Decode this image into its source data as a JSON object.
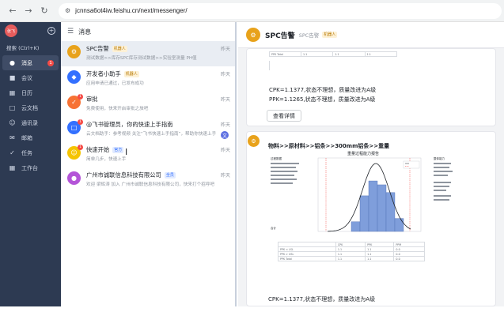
{
  "browser": {
    "url": "jcnnsa6ot4iw.feishu.cn/next/messenger/",
    "back_icon": "arrow-left-icon",
    "forward_icon": "arrow-right-icon",
    "reload_icon": "reload-icon"
  },
  "sidebar": {
    "avatar_text": "张飞",
    "search_label": "搜索 (Ctrl+K)",
    "items": [
      {
        "label": "消息",
        "icon": "chat-icon",
        "badge": "1",
        "active": true
      },
      {
        "label": "会议",
        "icon": "video-icon"
      },
      {
        "label": "日历",
        "icon": "calendar-icon"
      },
      {
        "label": "云文档",
        "icon": "doc-icon"
      },
      {
        "label": "通讯录",
        "icon": "contacts-icon"
      },
      {
        "label": "邮箱",
        "icon": "mail-icon"
      },
      {
        "label": "任务",
        "icon": "task-icon"
      },
      {
        "label": "工作台",
        "icon": "apps-icon"
      }
    ]
  },
  "chat_list": {
    "header": "消息",
    "items": [
      {
        "title": "SPC告警",
        "tag": "机器人",
        "time": "昨天",
        "preview": "测试数据>>库存SPC库存测试数据>>实验室测量 PH值",
        "color": "#e8a21b"
      },
      {
        "title": "开发者小助手",
        "tag": "机器人",
        "time": "昨天",
        "preview": "应用申请已通过，已发布成功",
        "color": "#3370ff"
      },
      {
        "title": "审批",
        "tag": "",
        "time": "昨天",
        "preview": "免费使用，快来开启审批之旅吧",
        "color": "#f77234",
        "badge": "1"
      },
      {
        "title": "@飞书管理员，你的快速上手指南",
        "tag": "",
        "time": "昨天",
        "preview": "云文档助手：参考视频 关注“飞书快速上手指南”，帮助你快速上手",
        "color": "#3370ff",
        "badge": "1",
        "chip": "文"
      },
      {
        "title": "快速开始",
        "tag": "官方",
        "tag_style": "blue",
        "time": "昨天",
        "preview": "简单几步，快速上手",
        "color": "#f5c400",
        "badge": "1"
      },
      {
        "title": "广州市诚联信息科技有限公司",
        "tag": "全员",
        "tag_style": "blue",
        "time": "昨天",
        "preview": "欢迎 梁辉涛 加入 广州市诚联信息科技有限公司，快来打个招呼吧",
        "color": "#b455d8"
      }
    ]
  },
  "chat_panel": {
    "title": "SPC告警",
    "subtitle": "SPC告警",
    "tag": "机器人",
    "card1": {
      "line1": "CPK=1.1377,状态不理想，质量改进为A级",
      "line2": "PPK=1.1265,状态不理想，质量改进为A级",
      "button": "查看详情"
    },
    "card2": {
      "title": "物料>>原材料>>铝条>>300mm铝条>>重量",
      "figure_title": "重量过程能力报告",
      "figure_left_label": "过程数据",
      "figure_right_label": "整体能力",
      "table_label": "合计",
      "bottom_line": "CPK=1.1377,状态不理想，质量改进为A级"
    }
  },
  "colors": {
    "sidebar_bg": "#2d3a52",
    "accent": "#3370ff",
    "histogram": "#7f9edb",
    "curve": "#1f2329"
  }
}
